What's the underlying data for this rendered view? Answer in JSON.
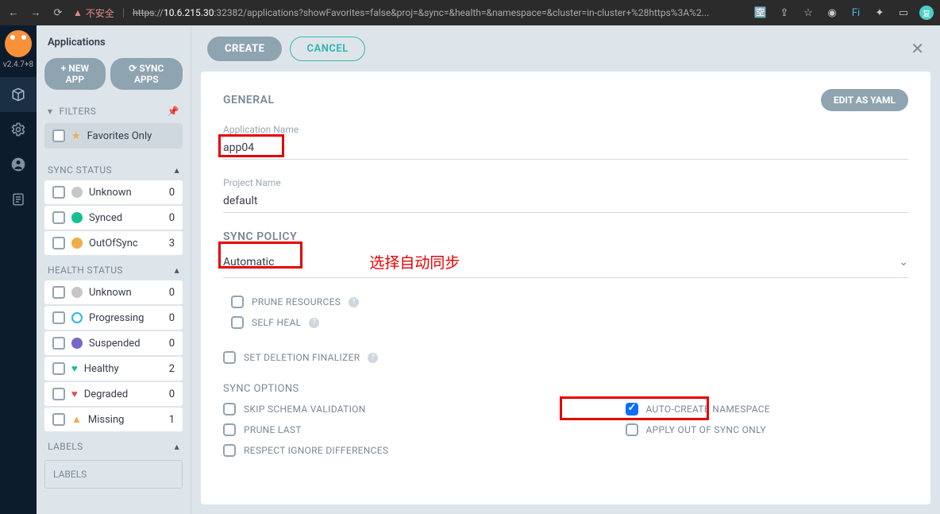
{
  "browser": {
    "warn_text": "不安全",
    "url_struck": "https",
    "url_host": "10.6.215.30",
    "url_rest": ":32382/applications?showFavorites=false&proj=&sync=&health=&namespace=&cluster=in-cluster+%28https%3A%2...",
    "avatar": "复"
  },
  "rail": {
    "version": "v2.4.7+8"
  },
  "sidebar": {
    "title": "Applications",
    "new_app": "+ NEW APP",
    "sync_apps": "⟳ SYNC APPS",
    "filters": "FILTERS",
    "favorites": "Favorites Only",
    "sync_status_title": "SYNC STATUS",
    "sync_status": [
      {
        "label": "Unknown",
        "count": "0",
        "icon": "ico-unknown"
      },
      {
        "label": "Synced",
        "count": "0",
        "icon": "ico-sync"
      },
      {
        "label": "OutOfSync",
        "count": "3",
        "icon": "ico-oos"
      }
    ],
    "health_status_title": "HEALTH STATUS",
    "health_status": [
      {
        "label": "Unknown",
        "count": "0",
        "icon": "ico-unknown",
        "shape": "circle"
      },
      {
        "label": "Progressing",
        "count": "0",
        "icon": "ico-prog",
        "shape": "circle"
      },
      {
        "label": "Suspended",
        "count": "0",
        "icon": "ico-susp",
        "shape": "circle"
      },
      {
        "label": "Healthy",
        "count": "2",
        "txt": "♥",
        "cls": "ico-heart"
      },
      {
        "label": "Degraded",
        "count": "0",
        "txt": "♥",
        "cls": "ico-broken"
      },
      {
        "label": "Missing",
        "count": "1",
        "txt": "▲",
        "cls": "ico-ghost"
      }
    ],
    "labels_title": "LABELS",
    "labels_box": "LABELS"
  },
  "form": {
    "create": "CREATE",
    "cancel": "CANCEL",
    "edit_yaml": "EDIT AS YAML",
    "general": "GENERAL",
    "app_name_label": "Application Name",
    "app_name_value": "app04",
    "proj_name_label": "Project Name",
    "proj_name_value": "default",
    "sync_policy_title": "SYNC POLICY",
    "sync_policy_value": "Automatic",
    "annotation_auto": "选择自动同步",
    "prune_resources": "PRUNE RESOURCES",
    "self_heal": "SELF HEAL",
    "set_deletion_finalizer": "SET DELETION FINALIZER",
    "sync_options_title": "SYNC OPTIONS",
    "opts_left": [
      "SKIP SCHEMA VALIDATION",
      "PRUNE LAST",
      "RESPECT IGNORE DIFFERENCES"
    ],
    "opts_right": [
      {
        "label": "AUTO-CREATE NAMESPACE",
        "checked": true
      },
      {
        "label": "APPLY OUT OF SYNC ONLY",
        "checked": false
      }
    ]
  }
}
